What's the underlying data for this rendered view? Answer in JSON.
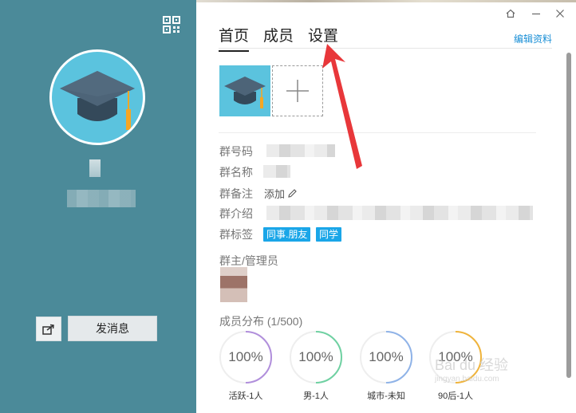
{
  "left_panel": {
    "qr_icon": "qr-code-icon",
    "share_icon": "share-icon",
    "send_message_label": "发消息"
  },
  "window_controls": [
    "home-icon",
    "minimize-icon",
    "close-icon"
  ],
  "tabs": [
    {
      "label": "首页",
      "active": true
    },
    {
      "label": "成员",
      "active": false
    },
    {
      "label": "设置",
      "active": false
    }
  ],
  "edit_profile_label": "编辑资料",
  "group_info": {
    "number_label": "群号码",
    "name_label": "群名称",
    "note_label": "群备注",
    "note_action": "添加",
    "intro_label": "群介绍",
    "tags_label": "群标签",
    "tags": [
      "同事.朋友",
      "同学"
    ]
  },
  "admins_title": "群主/管理员",
  "distribution": {
    "title": "成员分布 (1/500)",
    "gauges": [
      {
        "value": "100%",
        "label": "活跃-1人",
        "color": "#b18fdc"
      },
      {
        "value": "100%",
        "label": "男-1人",
        "color": "#6fd1a2"
      },
      {
        "value": "100%",
        "label": "城市-未知",
        "color": "#8fb3e8"
      },
      {
        "value": "100%",
        "label": "90后-1人",
        "color": "#f0b43c"
      }
    ]
  },
  "watermark": {
    "text": "Bai du 经验",
    "sub": "jingyan.baidu.com"
  },
  "colors": {
    "left_bg": "#4b8a99",
    "avatar_bg": "#5bc3de",
    "tag_bg": "#1aa6e8",
    "link": "#1a8fd6",
    "arrow": "#e8373a"
  }
}
